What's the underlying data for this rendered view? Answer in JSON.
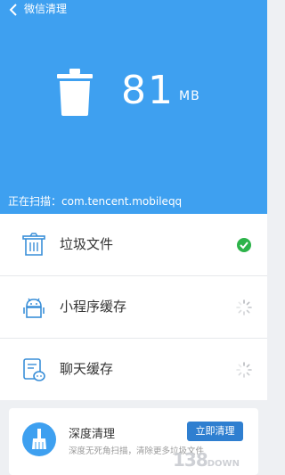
{
  "header": {
    "title": "微信清理",
    "size_value": "81",
    "size_unit": "MB",
    "scan_text": "正在扫描：com.tencent.mobileqq",
    "bg_color": "#3ea0f0"
  },
  "items": [
    {
      "label": "垃圾文件",
      "icon": "trash-bin-icon",
      "status": "done"
    },
    {
      "label": "小程序缓存",
      "icon": "android-robot-icon",
      "status": "loading"
    },
    {
      "label": "聊天缓存",
      "icon": "chat-document-icon",
      "status": "loading"
    }
  ],
  "card": {
    "title": "深度清理",
    "description": "深度无死角扫描，清除更多垃圾文件",
    "button_label": "立即清理",
    "icon": "broom-icon"
  },
  "watermark": {
    "main": "138",
    "suffix": "DOWN"
  },
  "colors": {
    "accent": "#3ea0f0",
    "success": "#2db34a",
    "button": "#2f7fd0"
  }
}
